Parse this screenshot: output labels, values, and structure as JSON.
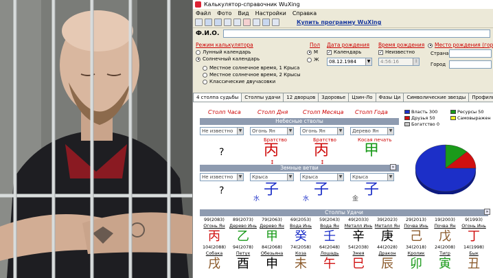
{
  "window": {
    "title": "Калькулятор-справочник WuXing"
  },
  "menu": [
    "Файл",
    "Фото",
    "Вид",
    "Настройки",
    "Справка"
  ],
  "toolbar": {
    "buy_link": "Купить программу WuXing"
  },
  "fio": {
    "label": "Ф.И.О.",
    "value": ""
  },
  "settings": {
    "mode_header": "Режим калькулятора",
    "lunar": "Лунный календарь",
    "solar": "Солнечный календарь",
    "sub_options": [
      "Местное солнечное время, 1 Крыса",
      "Местное солнечное время, 2 Крысы",
      "Классические двучасовки"
    ],
    "gender_header": "Пол",
    "male": "М",
    "female": "Ж",
    "birthdate_header": "Дата рождения",
    "calendar_check": "Календарь",
    "birthdate_value": "08.12.1984",
    "birthtime_header": "Время рождения",
    "unknown_check": "Неизвестно",
    "birthtime_value": "4:56:16",
    "place_header": "Место рождения (город)",
    "country_label": "Страна",
    "city_label": "Город"
  },
  "tabs": [
    "4 столпа судьбы",
    "Столпы удачи",
    "12 дворцов",
    "Здоровье",
    "Цзин-Ло",
    "Фазы Ци",
    "Символические звезды",
    "Профиль карты"
  ],
  "pillars": {
    "headers": [
      "Столп Часа",
      "Столп Дня",
      "Столп Месяца",
      "Столп Года"
    ],
    "stems_band": "Небесные стволы",
    "branches_band": "Земные ветви",
    "stems_select": [
      "Не известно",
      "Огонь Ян",
      "Огонь Ян",
      "Дерево Ян"
    ],
    "relations": [
      "",
      "Братство",
      "Братство",
      "Косая печать"
    ],
    "stems": [
      "?",
      "丙",
      "丙",
      "甲"
    ],
    "branches_select": [
      "Не известно",
      "Крыса",
      "Крыса",
      "Крыса"
    ],
    "branches": [
      "?",
      "子",
      "子",
      "子"
    ],
    "hidden": [
      "",
      "水",
      "水",
      "金"
    ]
  },
  "legend": {
    "items": [
      {
        "label": "Власть",
        "value": "300",
        "color": "#1c2fc8"
      },
      {
        "label": "Ресурсы",
        "value": "50",
        "color": "#1a9a1a"
      },
      {
        "label": "Друзья",
        "value": "50",
        "color": "#d01010"
      },
      {
        "label": "Самовыражен",
        "value": "",
        "color": "#f0f020"
      },
      {
        "label": "Богатство",
        "value": "0",
        "color": "#c8c8c8"
      }
    ]
  },
  "chart_data": {
    "type": "pie",
    "categories": [
      "Власть",
      "Ресурсы",
      "Друзья",
      "Самовыражен",
      "Богатство"
    ],
    "values": [
      300,
      50,
      50,
      0,
      0
    ],
    "colors": [
      "#1c2fc8",
      "#1a9a1a",
      "#d01010",
      "#f0f020",
      "#c8c8c8"
    ]
  },
  "luck": {
    "band": "Столпы Удачи",
    "cols": [
      {
        "top": "99(2083)",
        "stem_el": "Огонь Ян",
        "stem": "丙",
        "stem_color": "#d01010",
        "bot": "104(2088)",
        "br_el": "Собака",
        "branch": "戌",
        "br_color": "#8b5a2b"
      },
      {
        "top": "89(2073)",
        "stem_el": "Дерево Инь",
        "stem": "乙",
        "stem_color": "#1a9a1a",
        "bot": "94(2078)",
        "br_el": "Петух",
        "branch": "酉",
        "br_color": "#000"
      },
      {
        "top": "79(2063)",
        "stem_el": "Дерево Ян",
        "stem": "甲",
        "stem_color": "#1a9a1a",
        "bot": "84(2068)",
        "br_el": "Обезьяна",
        "branch": "申",
        "br_color": "#000"
      },
      {
        "top": "69(2053)",
        "stem_el": "Вода Инь",
        "stem": "癸",
        "stem_color": "#1c2fc8",
        "bot": "74(2058)",
        "br_el": "Коза",
        "branch": "未",
        "br_color": "#8b5a2b"
      },
      {
        "top": "59(2043)",
        "stem_el": "Вода Ян",
        "stem": "壬",
        "stem_color": "#1c2fc8",
        "bot": "64(2048)",
        "br_el": "Лошадь",
        "branch": "午",
        "br_color": "#d01010"
      },
      {
        "top": "49(2033)",
        "stem_el": "Металл Инь",
        "stem": "辛",
        "stem_color": "#000",
        "bot": "54(2038)",
        "br_el": "Змея",
        "branch": "巳",
        "br_color": "#d01010"
      },
      {
        "top": "39(2023)",
        "stem_el": "Металл Ян",
        "stem": "庚",
        "stem_color": "#000",
        "bot": "44(2028)",
        "br_el": "Дракон",
        "branch": "辰",
        "br_color": "#8b5a2b"
      },
      {
        "top": "29(2013)",
        "stem_el": "Почва Инь",
        "stem": "己",
        "stem_color": "#8b5a2b",
        "bot": "34(2018)",
        "br_el": "Кролик",
        "branch": "卯",
        "br_color": "#1a9a1a"
      },
      {
        "top": "19(2003)",
        "stem_el": "Почва Ян",
        "stem": "戊",
        "stem_color": "#8b5a2b",
        "bot": "24(2008)",
        "br_el": "Тигр",
        "branch": "寅",
        "br_color": "#1a9a1a"
      },
      {
        "top": "9(1993)",
        "stem_el": "Огонь Инь",
        "stem": "丁",
        "stem_color": "#d01010",
        "bot": "14(1998)",
        "br_el": "Бык",
        "branch": "丑",
        "br_color": "#8b5a2b"
      }
    ]
  }
}
